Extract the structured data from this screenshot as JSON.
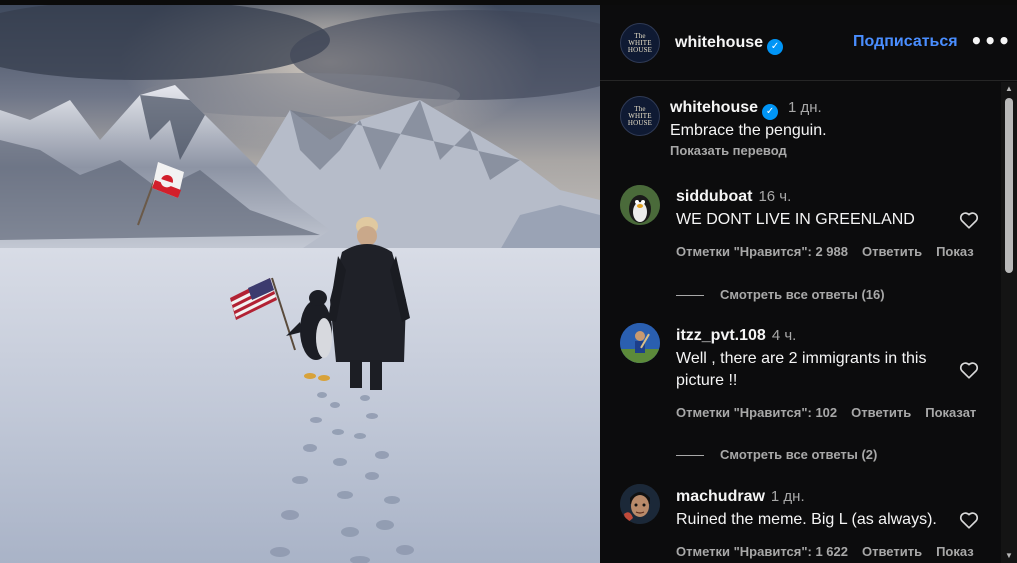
{
  "post_author": {
    "username": "whitehouse",
    "avatar_text": [
      "The",
      "WHITE",
      "HOUSE"
    ],
    "verified": true
  },
  "header": {
    "follow_label": "Подписаться",
    "more_label": "•••"
  },
  "caption": {
    "username": "whitehouse",
    "time": "1 дн.",
    "text": "Embrace the penguin.",
    "translate_label": "Показать перевод"
  },
  "comments": [
    {
      "username": "sidduboat",
      "time": "16 ч.",
      "text": "WE DONT LIVE IN GREENLAND",
      "likes_label": "Отметки \"Нравится\": 2 988",
      "reply_label": "Ответить",
      "translate_label": "Показ",
      "view_replies": "Смотреть все ответы (16)"
    },
    {
      "username": "itzz_pvt.108",
      "time": "4 ч.",
      "text_lines": [
        "Well , there are 2 immigrants in this",
        "picture !!"
      ],
      "likes_label": "Отметки \"Нравится\": 102",
      "reply_label": "Ответить",
      "translate_label": "Показат",
      "view_replies": "Смотреть все ответы (2)"
    },
    {
      "username": "machudraw",
      "time": "1 дн.",
      "text": "Ruined the meme. Big L (as always).",
      "likes_label": "Отметки \"Нравится\": 1 622",
      "reply_label": "Ответить",
      "translate_label": "Показ"
    }
  ],
  "icons": {
    "verified": "verified-badge-icon",
    "heart": "heart-outline-icon",
    "more": "more-horizontal-icon"
  },
  "colors": {
    "panel_bg": "#0c0c0d",
    "link_blue": "#4a8eff",
    "verified_blue": "#0095f6",
    "secondary_text": "#a8a8a8"
  }
}
